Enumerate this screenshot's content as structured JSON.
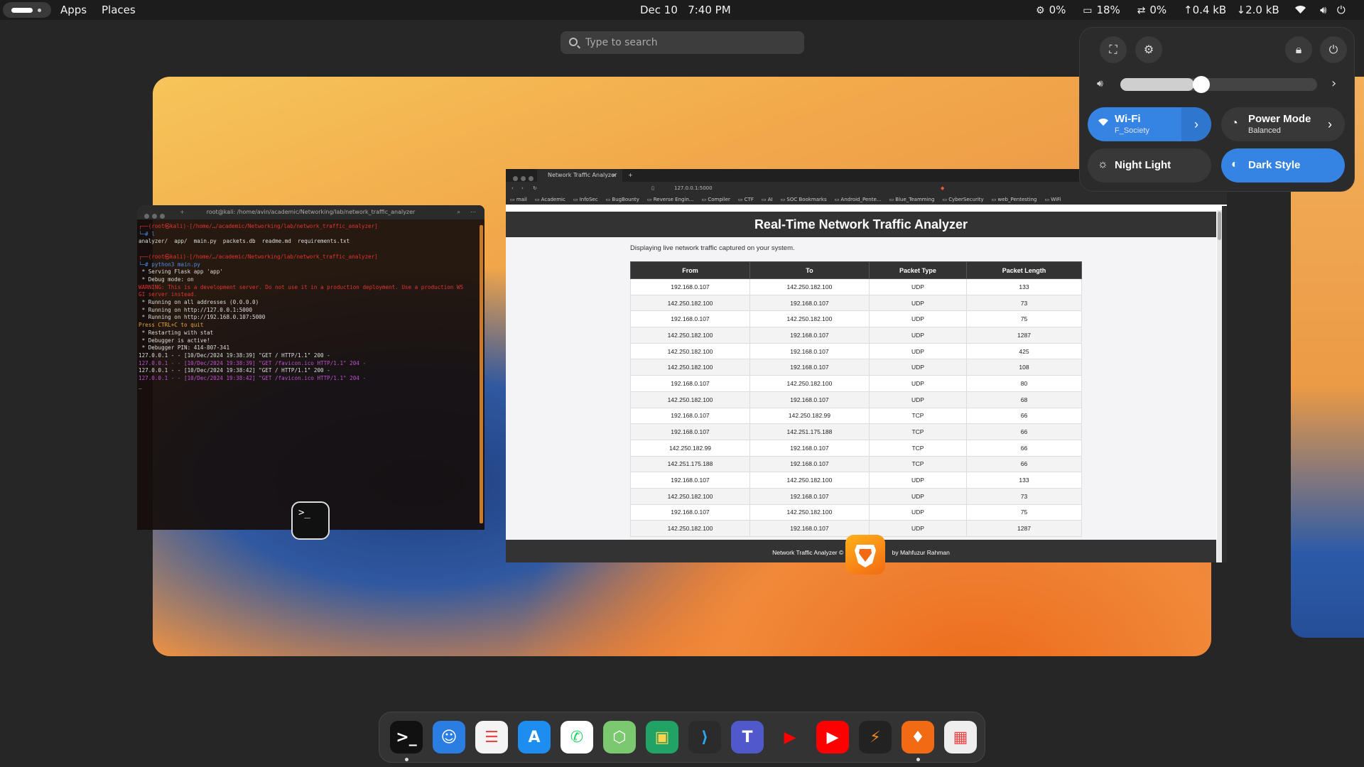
{
  "topbar": {
    "apps": "Apps",
    "places": "Places",
    "date": "Dec 10",
    "time": "7:40 PM",
    "cpu": "0%",
    "mem": "18%",
    "swap": "0%",
    "net_up": "0.4 kB",
    "net_down": "2.0 kB"
  },
  "search": {
    "placeholder": "Type to search"
  },
  "terminal": {
    "title": "root@kali: /home/avin/academic/Networking/lab/network_traffic_analyzer",
    "lines": [
      {
        "t": "┌──(root㉿kali)-[/home/…/academic/Networking/lab/network_traffic_analyzer]",
        "c": "tr"
      },
      {
        "t": "└─# l",
        "c": "tb2"
      },
      {
        "t": "analyzer/  app/  main.py  packets.db  readme.md  requirements.txt",
        "c": ""
      },
      {
        "t": " ",
        "c": ""
      },
      {
        "t": "┌──(root㉿kali)-[/home/…/academic/Networking/lab/network_traffic_analyzer]",
        "c": "tr"
      },
      {
        "t": "└─# python3 main.py",
        "c": "tb2"
      },
      {
        "t": " * Serving Flask app 'app'",
        "c": ""
      },
      {
        "t": " * Debug mode: on",
        "c": ""
      },
      {
        "t": "WARNING: This is a development server. Do not use it in a production deployment. Use a production WS",
        "c": "tr"
      },
      {
        "t": "GI server instead.",
        "c": "tr"
      },
      {
        "t": " * Running on all addresses (0.0.0.0)",
        "c": ""
      },
      {
        "t": " * Running on http://127.0.0.1:5000",
        "c": ""
      },
      {
        "t": " * Running on http://192.168.0.107:5000",
        "c": ""
      },
      {
        "t": "Press CTRL+C to quit",
        "c": "to"
      },
      {
        "t": " * Restarting with stat",
        "c": ""
      },
      {
        "t": " * Debugger is active!",
        "c": ""
      },
      {
        "t": " * Debugger PIN: 414-807-341",
        "c": ""
      },
      {
        "t": "127.0.0.1 - - [10/Dec/2024 19:38:39] \"GET / HTTP/1.1\" 200 -",
        "c": ""
      },
      {
        "t": "127.0.0.1 - - [10/Dec/2024 19:38:39] \"GET /favicon.ico HTTP/1.1\" 204 -",
        "c": "tp"
      },
      {
        "t": "127.0.0.1 - - [10/Dec/2024 19:38:42] \"GET / HTTP/1.1\" 200 -",
        "c": ""
      },
      {
        "t": "127.0.0.1 - - [10/Dec/2024 19:38:42] \"GET /favicon.ico HTTP/1.1\" 204 -",
        "c": "tp"
      },
      {
        "t": "_",
        "c": ""
      }
    ]
  },
  "browser": {
    "tab": "Network Traffic Analyzer",
    "url": "127.0.0.1:5000",
    "bookmarks": [
      "mail",
      "Academic",
      "InfoSec",
      "BugBounty",
      "Reverse Engin...",
      "Compiler",
      "CTF",
      "AI",
      "SOC Bookmarks",
      "Android_Pente...",
      "Blue_Teamming",
      "CyberSecurity",
      "web_Pentesting",
      "WiFi"
    ],
    "heading": "Real-Time Network Traffic Analyzer",
    "desc": "Displaying live network traffic captured on your system.",
    "columns": [
      "From",
      "To",
      "Packet Type",
      "Packet Length"
    ],
    "rows": [
      [
        "192.168.0.107",
        "142.250.182.100",
        "UDP",
        "133"
      ],
      [
        "142.250.182.100",
        "192.168.0.107",
        "UDP",
        "73"
      ],
      [
        "192.168.0.107",
        "142.250.182.100",
        "UDP",
        "75"
      ],
      [
        "142.250.182.100",
        "192.168.0.107",
        "UDP",
        "1287"
      ],
      [
        "142.250.182.100",
        "192.168.0.107",
        "UDP",
        "425"
      ],
      [
        "142.250.182.100",
        "192.168.0.107",
        "UDP",
        "108"
      ],
      [
        "192.168.0.107",
        "142.250.182.100",
        "UDP",
        "80"
      ],
      [
        "142.250.182.100",
        "192.168.0.107",
        "UDP",
        "68"
      ],
      [
        "192.168.0.107",
        "142.250.182.99",
        "TCP",
        "66"
      ],
      [
        "192.168.0.107",
        "142.251.175.188",
        "TCP",
        "66"
      ],
      [
        "142.250.182.99",
        "192.168.0.107",
        "TCP",
        "66"
      ],
      [
        "142.251.175.188",
        "192.168.0.107",
        "TCP",
        "66"
      ],
      [
        "192.168.0.107",
        "142.250.182.100",
        "UDP",
        "133"
      ],
      [
        "142.250.182.100",
        "192.168.0.107",
        "UDP",
        "73"
      ],
      [
        "192.168.0.107",
        "142.250.182.100",
        "UDP",
        "75"
      ],
      [
        "142.250.182.100",
        "192.168.0.107",
        "UDP",
        "1287"
      ]
    ],
    "footer_left": "Network Traffic Analyzer ©",
    "footer_right": "by Mahfuzur Rahman"
  },
  "quick_settings": {
    "volume": 0.34,
    "wifi": {
      "title": "Wi-Fi",
      "subtitle": "F_Society"
    },
    "power": {
      "title": "Power Mode",
      "subtitle": "Balanced"
    },
    "night": {
      "title": "Night Light"
    },
    "dark": {
      "title": "Dark Style"
    },
    "accent": "#3584e4"
  },
  "dock": {
    "apps": [
      "terminal",
      "finder",
      "reminders",
      "app-store",
      "whatsapp",
      "boxes",
      "classroom",
      "vscode",
      "teams",
      "youtube",
      "youtube-music",
      "sublime-merge",
      "brave",
      "app-grid"
    ]
  }
}
